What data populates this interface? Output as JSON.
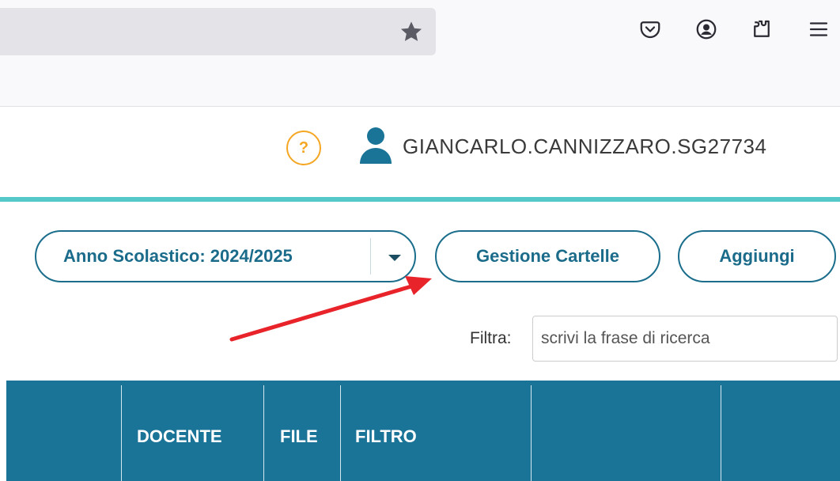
{
  "browser": {
    "toolbar_icons": [
      "star-icon",
      "pocket-icon",
      "account-icon",
      "extensions-icon",
      "menu-icon"
    ]
  },
  "header": {
    "help_label": "?",
    "user_name": "GIANCARLO.CANNIZZARO.SG27734"
  },
  "toolbar": {
    "year_label": "Anno Scolastico: 2024/2025",
    "manage_folders_label": "Gestione Cartelle",
    "add_label": "Aggiungi"
  },
  "filter": {
    "label": "Filtra:",
    "placeholder": "scrivi la frase di ricerca"
  },
  "table": {
    "columns": [
      "",
      "DOCENTE",
      "FILE",
      "FILTRO",
      "",
      ""
    ]
  },
  "colors": {
    "primary": "#1a7498",
    "accent_line": "#55c9c9",
    "help": "#f5a623",
    "annotation_arrow": "#e8232a"
  }
}
